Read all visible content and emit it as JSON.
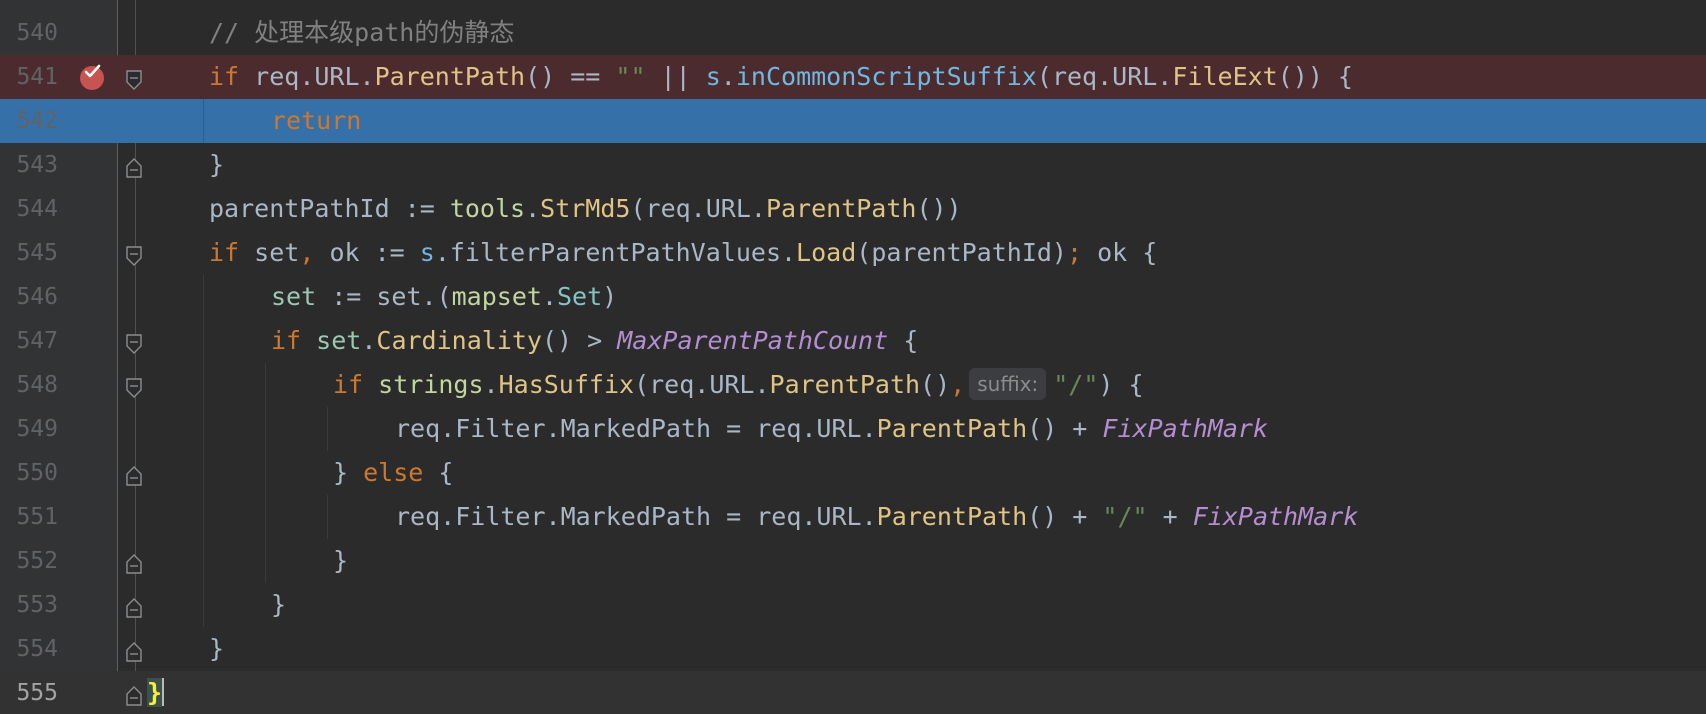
{
  "editor": {
    "lines": [
      {
        "num": "540",
        "tokens": [
          [
            "cm",
            "// 处理本级path的伪静态"
          ]
        ]
      },
      {
        "num": "541",
        "tokens": [
          [
            "kw",
            "if"
          ],
          [
            "pl",
            " req.URL."
          ],
          [
            "fn",
            "ParentPath"
          ],
          [
            "pl",
            "() == "
          ],
          [
            "str",
            "\"\""
          ],
          [
            "pl",
            " || "
          ],
          [
            "rcv",
            "s"
          ],
          [
            "pl",
            "."
          ],
          [
            "rcv",
            "inCommonScriptSuffix"
          ],
          [
            "pl",
            "(req.URL."
          ],
          [
            "fn",
            "FileExt"
          ],
          [
            "pl",
            "()) {"
          ]
        ]
      },
      {
        "num": "542",
        "tokens": [
          [
            "kw",
            "return"
          ]
        ]
      },
      {
        "num": "543",
        "tokens": [
          [
            "pl",
            "}"
          ]
        ]
      },
      {
        "num": "544",
        "tokens": [
          [
            "pl",
            "parentPathId := "
          ],
          [
            "pkg",
            "tools"
          ],
          [
            "pl",
            "."
          ],
          [
            "fn",
            "StrMd5"
          ],
          [
            "pl",
            "(req.URL."
          ],
          [
            "fn",
            "ParentPath"
          ],
          [
            "pl",
            "())"
          ]
        ]
      },
      {
        "num": "545",
        "tokens": [
          [
            "kw",
            "if"
          ],
          [
            "pl",
            " set"
          ],
          [
            "kw",
            ","
          ],
          [
            "pl",
            " ok := "
          ],
          [
            "rcv",
            "s"
          ],
          [
            "pl",
            ".filterParentPathValues."
          ],
          [
            "fn",
            "Load"
          ],
          [
            "pl",
            "(parentPathId)"
          ],
          [
            "kw",
            ";"
          ],
          [
            "pl",
            " ok {"
          ]
        ]
      },
      {
        "num": "546",
        "tokens": [
          [
            "local",
            "set"
          ],
          [
            "pl",
            " := set.("
          ],
          [
            "pkg",
            "mapset"
          ],
          [
            "pl",
            "."
          ],
          [
            "type",
            "Set"
          ],
          [
            "pl",
            ")"
          ]
        ]
      },
      {
        "num": "547",
        "tokens": [
          [
            "kw",
            "if"
          ],
          [
            "pl",
            " "
          ],
          [
            "local",
            "set"
          ],
          [
            "pl",
            "."
          ],
          [
            "fn",
            "Cardinality"
          ],
          [
            "pl",
            "() > "
          ],
          [
            "konst",
            "MaxParentPathCount"
          ],
          [
            "pl",
            " {"
          ]
        ]
      },
      {
        "num": "548",
        "tokens": [
          [
            "kw",
            "if"
          ],
          [
            "pl",
            " "
          ],
          [
            "pkg",
            "strings"
          ],
          [
            "pl",
            "."
          ],
          [
            "fn",
            "HasSuffix"
          ],
          [
            "pl",
            "(req.URL."
          ],
          [
            "fn",
            "ParentPath"
          ],
          [
            "pl",
            "()"
          ],
          [
            "kw",
            ","
          ],
          [
            "hint",
            "suffix:"
          ],
          [
            "str",
            "\"/\""
          ],
          [
            "pl",
            ") {"
          ]
        ]
      },
      {
        "num": "549",
        "tokens": [
          [
            "pl",
            "req.Filter.MarkedPath = req.URL."
          ],
          [
            "fn",
            "ParentPath"
          ],
          [
            "pl",
            "() + "
          ],
          [
            "konst",
            "FixPathMark"
          ]
        ]
      },
      {
        "num": "550",
        "tokens": [
          [
            "pl",
            "} "
          ],
          [
            "kw",
            "else"
          ],
          [
            "pl",
            " {"
          ]
        ]
      },
      {
        "num": "551",
        "tokens": [
          [
            "pl",
            "req.Filter.MarkedPath = req.URL."
          ],
          [
            "fn",
            "ParentPath"
          ],
          [
            "pl",
            "() + "
          ],
          [
            "str",
            "\"/\""
          ],
          [
            "pl",
            " + "
          ],
          [
            "konst",
            "FixPathMark"
          ]
        ]
      },
      {
        "num": "552",
        "tokens": [
          [
            "pl",
            "}"
          ]
        ]
      },
      {
        "num": "553",
        "tokens": [
          [
            "pl",
            "}"
          ]
        ]
      },
      {
        "num": "554",
        "tokens": [
          [
            "pl",
            "}"
          ]
        ]
      },
      {
        "num": "555",
        "tokens": [
          [
            "brace",
            "}"
          ]
        ]
      }
    ]
  },
  "colors": {
    "background": "#2b2b2b",
    "gutter": "#313335",
    "breakpoint_line": "#4c2b2e",
    "selected_line": "#3670a8",
    "breakpoint": "#c75450"
  },
  "icons": {
    "breakpoint": "breakpoint-checked-icon",
    "fold": "fold-marker-icon"
  }
}
